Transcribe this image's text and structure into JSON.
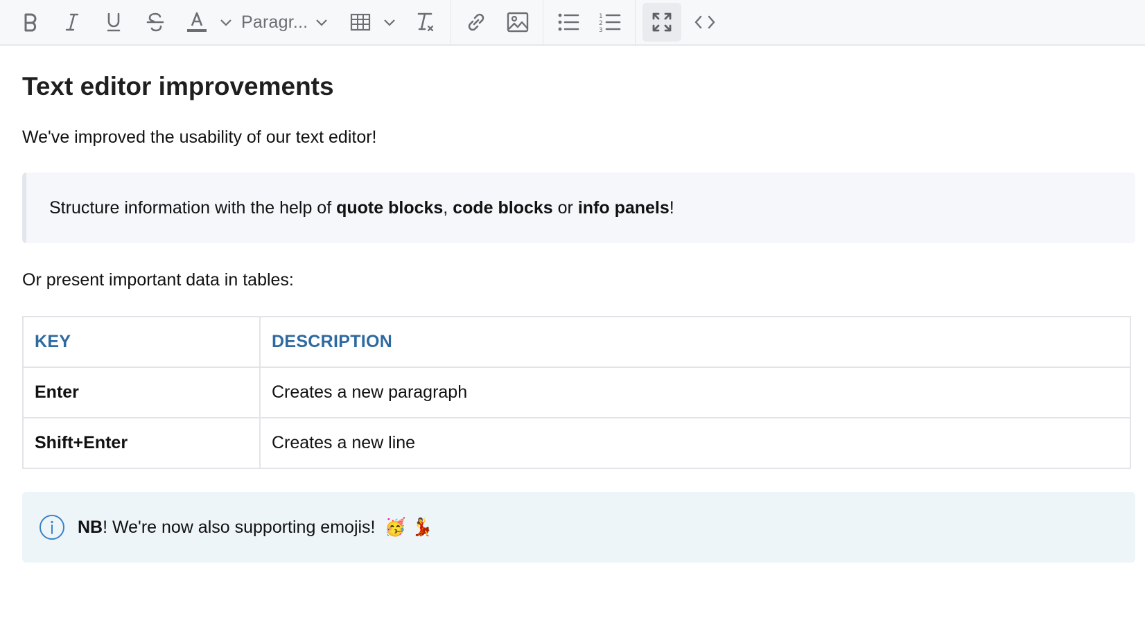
{
  "toolbar": {
    "paragraph_style": "Paragr...",
    "icons": [
      "bold-icon",
      "italic-icon",
      "underline-icon",
      "strikethrough-icon",
      "text-color-icon",
      "chevron-down-icon",
      "table-icon",
      "clear-format-icon",
      "link-icon",
      "image-icon",
      "bullet-list-icon",
      "numbered-list-icon",
      "fullscreen-icon",
      "code-icon"
    ]
  },
  "doc": {
    "title": "Text editor improvements",
    "intro": "We've improved the usability of our text editor!",
    "quote": {
      "pre": "Structure information with the help of ",
      "b1": "quote blocks",
      "sep1": ", ",
      "b2": "code blocks",
      "sep2": " or ",
      "b3": "info panels",
      "end": "!"
    },
    "table_intro": "Or present important data in tables:",
    "table": {
      "headers": [
        "KEY",
        "DESCRIPTION"
      ],
      "rows": [
        [
          "Enter",
          "Creates a new paragraph"
        ],
        [
          "Shift+Enter",
          "Creates a new line"
        ]
      ]
    },
    "info": {
      "bold": "NB",
      "text": "! We're now also supporting emojis! ",
      "emojis": "🥳 💃"
    }
  },
  "colors": {
    "toolbar_bg": "#f7f8fa",
    "header_blue": "#2e6aa0",
    "info_bg": "#eef5f8",
    "info_icon": "#3b82c4"
  }
}
